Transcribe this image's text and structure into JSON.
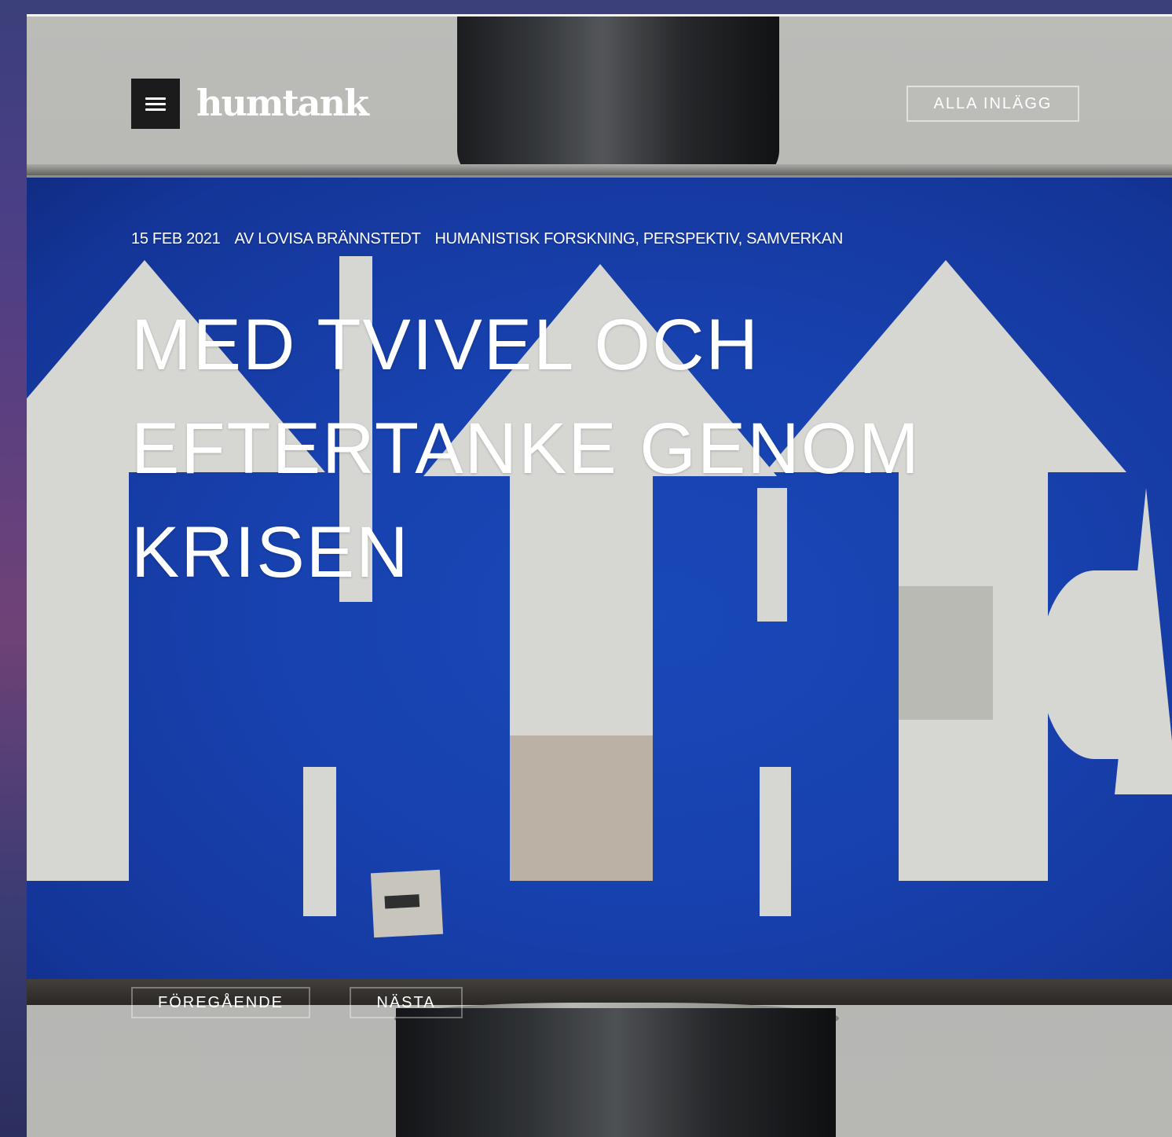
{
  "header": {
    "logo_text": "humtank",
    "all_posts_label": "ALLA INLÄGG"
  },
  "post": {
    "date": "15 FEB 2021",
    "author": "AV LOVISA BRÄNNSTEDT",
    "categories": "HUMANISTISK FORSKNING, PERSPEKTIV, SAMVERKAN",
    "title": "MED TVIVEL OCH EFTERTANKE GENOM KRISEN"
  },
  "pagination": {
    "previous_label": "FÖREGÅENDE",
    "next_label": "NÄSTA"
  },
  "colors": {
    "sign_blue": "#1a47bd",
    "menu_button_bg": "#1b1b1b",
    "text": "#ffffff"
  },
  "icons": {
    "menu": "hamburger-icon"
  }
}
